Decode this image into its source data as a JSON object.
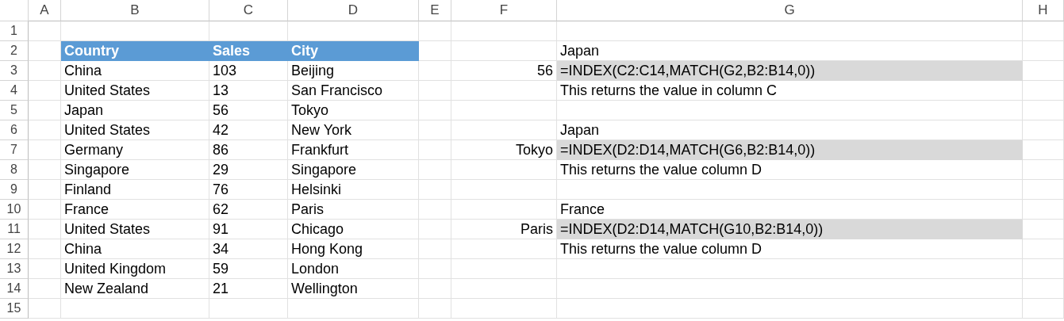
{
  "columns": [
    {
      "label": "A"
    },
    {
      "label": "B"
    },
    {
      "label": "C"
    },
    {
      "label": "D"
    },
    {
      "label": "E"
    },
    {
      "label": "F"
    },
    {
      "label": "G"
    },
    {
      "label": "H"
    }
  ],
  "rows": [
    {
      "number": "1",
      "cells": [
        {
          "kind": "empty"
        },
        {
          "kind": "empty"
        },
        {
          "kind": "empty"
        },
        {
          "kind": "empty"
        },
        {
          "kind": "empty"
        },
        {
          "kind": "empty"
        },
        {
          "kind": "empty"
        },
        {
          "kind": "empty"
        }
      ]
    },
    {
      "number": "2",
      "cells": [
        {
          "kind": "empty"
        },
        {
          "kind": "header",
          "text": "Country"
        },
        {
          "kind": "header",
          "text": "Sales"
        },
        {
          "kind": "header",
          "text": "City"
        },
        {
          "kind": "empty"
        },
        {
          "kind": "empty"
        },
        {
          "kind": "text",
          "text": "Japan"
        },
        {
          "kind": "empty"
        }
      ]
    },
    {
      "number": "3",
      "cells": [
        {
          "kind": "empty"
        },
        {
          "kind": "text",
          "text": "China"
        },
        {
          "kind": "text",
          "text": "103"
        },
        {
          "kind": "text",
          "text": "Beijing"
        },
        {
          "kind": "empty"
        },
        {
          "kind": "right",
          "text": "56"
        },
        {
          "kind": "formula",
          "text": "=INDEX(C2:C14,MATCH(G2,B2:B14,0))"
        },
        {
          "kind": "empty"
        }
      ]
    },
    {
      "number": "4",
      "cells": [
        {
          "kind": "empty"
        },
        {
          "kind": "text",
          "text": "United States"
        },
        {
          "kind": "text",
          "text": "13"
        },
        {
          "kind": "text",
          "text": "San Francisco"
        },
        {
          "kind": "empty"
        },
        {
          "kind": "empty"
        },
        {
          "kind": "text",
          "text": "This returns the value in column C"
        },
        {
          "kind": "empty"
        }
      ]
    },
    {
      "number": "5",
      "cells": [
        {
          "kind": "empty"
        },
        {
          "kind": "text",
          "text": "Japan"
        },
        {
          "kind": "text",
          "text": "56"
        },
        {
          "kind": "text",
          "text": "Tokyo"
        },
        {
          "kind": "empty"
        },
        {
          "kind": "empty"
        },
        {
          "kind": "empty"
        },
        {
          "kind": "empty"
        }
      ]
    },
    {
      "number": "6",
      "cells": [
        {
          "kind": "empty"
        },
        {
          "kind": "text",
          "text": "United States"
        },
        {
          "kind": "text",
          "text": "42"
        },
        {
          "kind": "text",
          "text": "New York"
        },
        {
          "kind": "empty"
        },
        {
          "kind": "empty"
        },
        {
          "kind": "text",
          "text": "Japan"
        },
        {
          "kind": "empty"
        }
      ]
    },
    {
      "number": "7",
      "cells": [
        {
          "kind": "empty"
        },
        {
          "kind": "text",
          "text": "Germany"
        },
        {
          "kind": "text",
          "text": "86"
        },
        {
          "kind": "text",
          "text": "Frankfurt"
        },
        {
          "kind": "empty"
        },
        {
          "kind": "right",
          "text": "Tokyo"
        },
        {
          "kind": "formula",
          "text": "=INDEX(D2:D14,MATCH(G6,B2:B14,0))"
        },
        {
          "kind": "empty"
        }
      ]
    },
    {
      "number": "8",
      "cells": [
        {
          "kind": "empty"
        },
        {
          "kind": "text",
          "text": "Singapore"
        },
        {
          "kind": "text",
          "text": "29"
        },
        {
          "kind": "text",
          "text": "Singapore"
        },
        {
          "kind": "empty"
        },
        {
          "kind": "empty"
        },
        {
          "kind": "text",
          "text": "This returns the value column D"
        },
        {
          "kind": "empty"
        }
      ]
    },
    {
      "number": "9",
      "cells": [
        {
          "kind": "empty"
        },
        {
          "kind": "text",
          "text": "Finland"
        },
        {
          "kind": "text",
          "text": "76"
        },
        {
          "kind": "text",
          "text": "Helsinki"
        },
        {
          "kind": "empty"
        },
        {
          "kind": "empty"
        },
        {
          "kind": "empty"
        },
        {
          "kind": "empty"
        }
      ]
    },
    {
      "number": "10",
      "cells": [
        {
          "kind": "empty"
        },
        {
          "kind": "text",
          "text": "France"
        },
        {
          "kind": "text",
          "text": "62"
        },
        {
          "kind": "text",
          "text": "Paris"
        },
        {
          "kind": "empty"
        },
        {
          "kind": "empty"
        },
        {
          "kind": "text",
          "text": "France"
        },
        {
          "kind": "empty"
        }
      ]
    },
    {
      "number": "11",
      "cells": [
        {
          "kind": "empty"
        },
        {
          "kind": "text",
          "text": "United States"
        },
        {
          "kind": "text",
          "text": "91"
        },
        {
          "kind": "text",
          "text": "Chicago"
        },
        {
          "kind": "empty"
        },
        {
          "kind": "right",
          "text": "Paris"
        },
        {
          "kind": "formula",
          "text": "=INDEX(D2:D14,MATCH(G10,B2:B14,0))"
        },
        {
          "kind": "empty"
        }
      ]
    },
    {
      "number": "12",
      "cells": [
        {
          "kind": "empty"
        },
        {
          "kind": "text",
          "text": "China"
        },
        {
          "kind": "text",
          "text": "34"
        },
        {
          "kind": "text",
          "text": "Hong Kong"
        },
        {
          "kind": "empty"
        },
        {
          "kind": "empty"
        },
        {
          "kind": "text",
          "text": "This returns the value column D"
        },
        {
          "kind": "empty"
        }
      ]
    },
    {
      "number": "13",
      "cells": [
        {
          "kind": "empty"
        },
        {
          "kind": "text",
          "text": "United Kingdom"
        },
        {
          "kind": "text",
          "text": "59"
        },
        {
          "kind": "text",
          "text": "London"
        },
        {
          "kind": "empty"
        },
        {
          "kind": "empty"
        },
        {
          "kind": "empty"
        },
        {
          "kind": "empty"
        }
      ]
    },
    {
      "number": "14",
      "cells": [
        {
          "kind": "empty"
        },
        {
          "kind": "text",
          "text": "New Zealand"
        },
        {
          "kind": "text",
          "text": "21"
        },
        {
          "kind": "text",
          "text": "Wellington"
        },
        {
          "kind": "empty"
        },
        {
          "kind": "empty"
        },
        {
          "kind": "empty"
        },
        {
          "kind": "empty"
        }
      ]
    },
    {
      "number": "15",
      "cells": [
        {
          "kind": "empty"
        },
        {
          "kind": "empty"
        },
        {
          "kind": "empty"
        },
        {
          "kind": "empty"
        },
        {
          "kind": "empty"
        },
        {
          "kind": "empty"
        },
        {
          "kind": "empty"
        },
        {
          "kind": "empty"
        }
      ]
    }
  ]
}
